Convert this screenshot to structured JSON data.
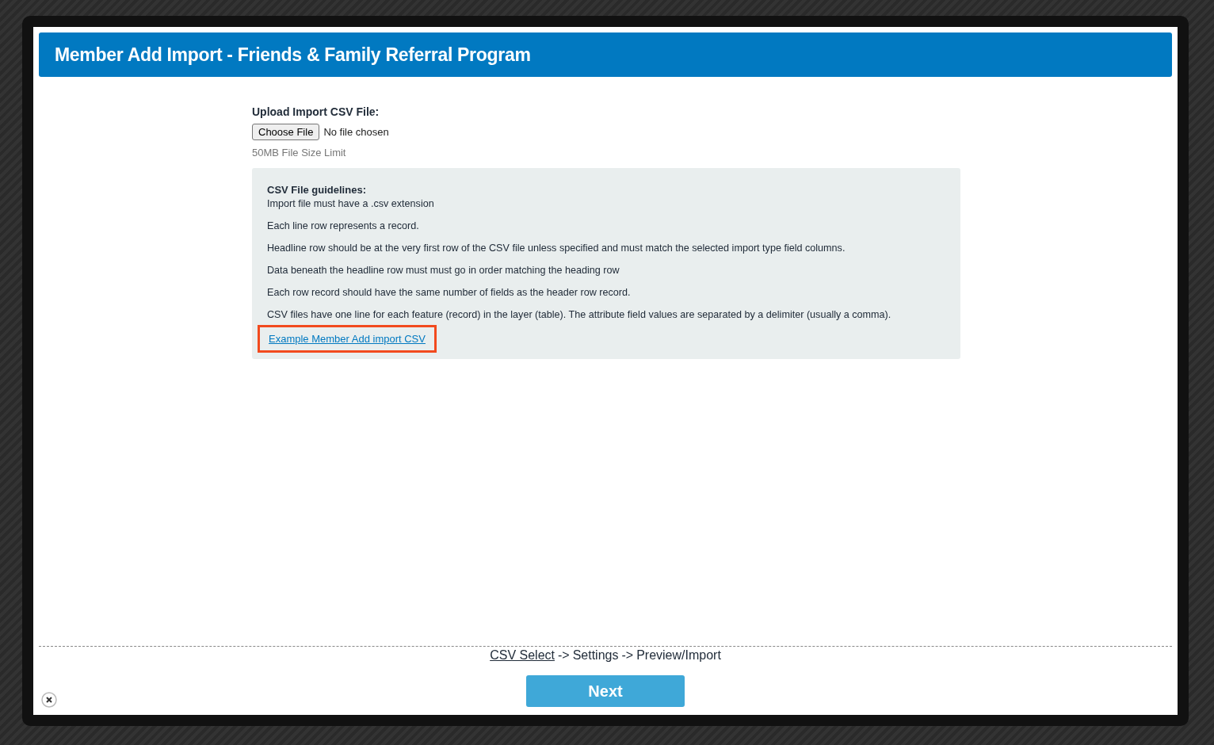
{
  "header": {
    "title": "Member Add Import - Friends & Family Referral Program"
  },
  "upload": {
    "label": "Upload Import CSV File:",
    "button": "Choose File",
    "status": "No file chosen",
    "hint": "50MB File Size Limit"
  },
  "guidelines": {
    "title": "CSV File guidelines:",
    "lines": [
      "Import file must have a .csv extension",
      "Each line row represents a record.",
      "Headline row should be at the very first row of the CSV file unless specified and must match the selected import type field columns.",
      "Data beneath the headline row must must go in order matching the heading row",
      "Each row record should have the same number of fields as the header row record.",
      "CSV files have one line for each feature (record) in the layer (table). The attribute field values are separated by a delimiter (usually a comma)."
    ],
    "link": {
      "label": "Example Member Add import CSV",
      "highlighted": true
    }
  },
  "steps": [
    {
      "label": "CSV Select",
      "kind": "step",
      "selected": true
    },
    {
      "label": "->",
      "kind": "separator"
    },
    {
      "label": "Settings",
      "kind": "step",
      "selected": false
    },
    {
      "label": "->",
      "kind": "separator"
    },
    {
      "label": "Preview/Import",
      "kind": "step",
      "selected": false
    }
  ],
  "next_button": "Next"
}
